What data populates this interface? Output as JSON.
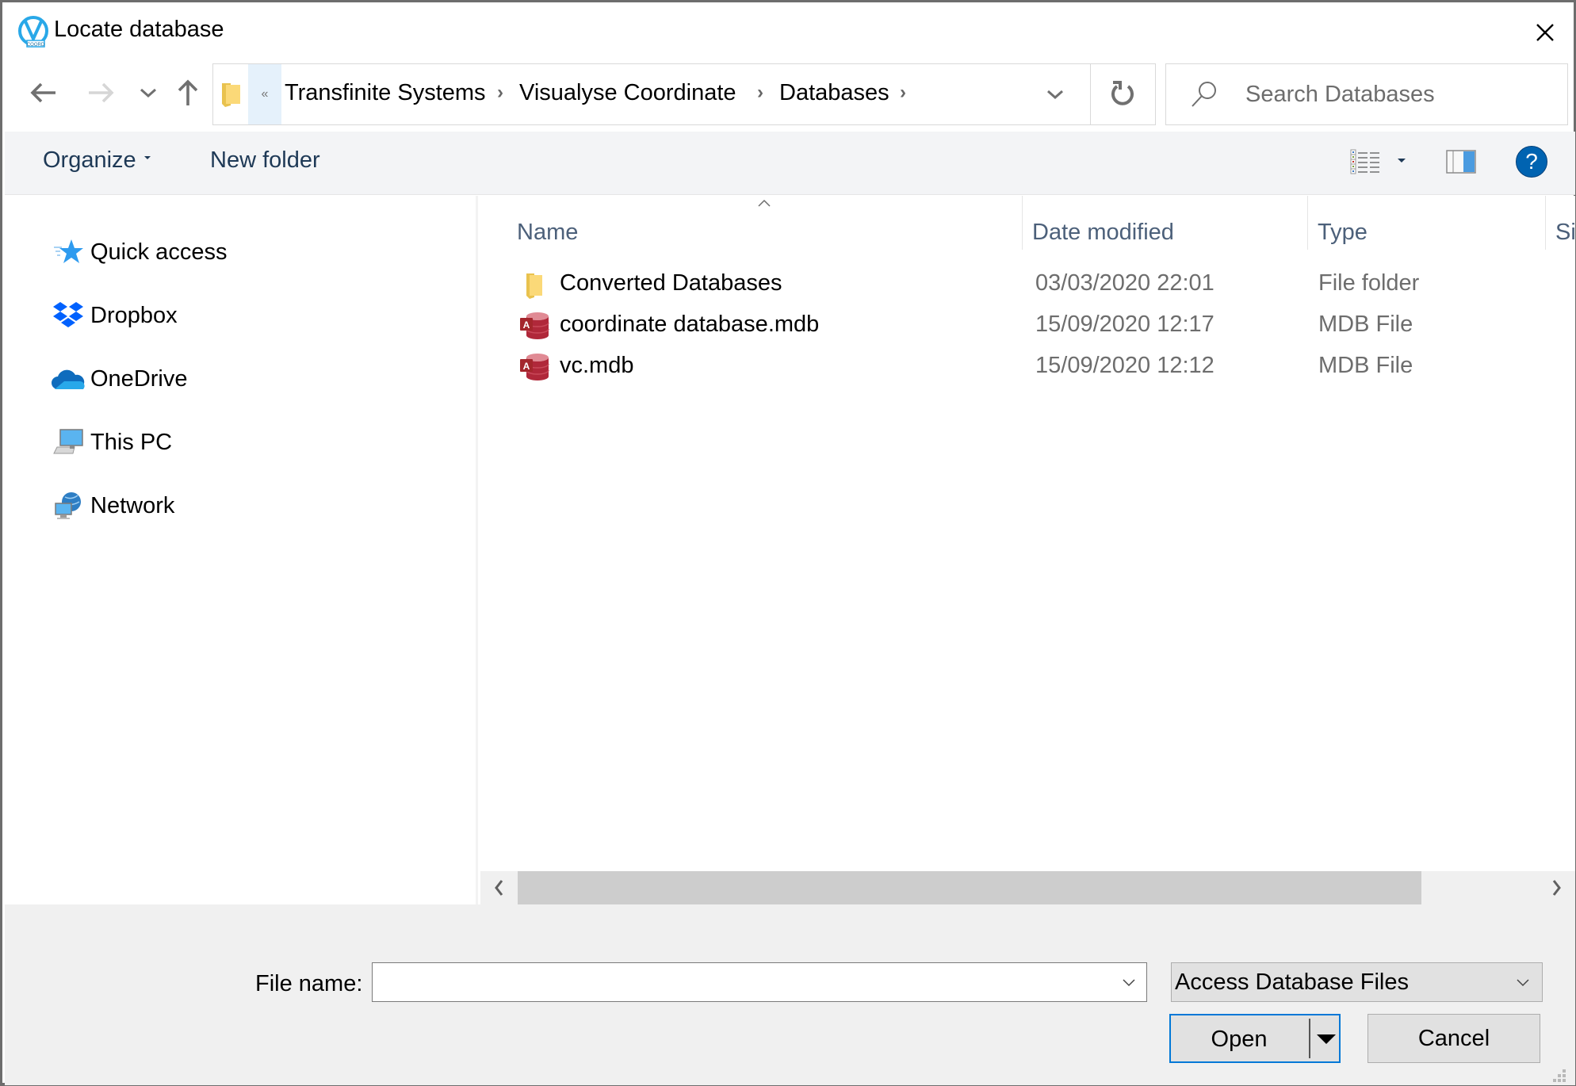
{
  "window": {
    "title": "Locate database",
    "app_icon": "visualyse-coord-icon"
  },
  "nav": {
    "back_icon": "arrow-left-icon",
    "forward_icon": "arrow-right-icon",
    "recent_icon": "chevron-down-icon",
    "up_icon": "arrow-up-icon",
    "overflow_label": "«",
    "breadcrumbs": [
      {
        "label": "Transfinite Systems"
      },
      {
        "label": "Visualyse Coordinate"
      },
      {
        "label": "Databases"
      }
    ],
    "search_placeholder": "Search Databases",
    "search_value": ""
  },
  "toolbar": {
    "organize_label": "Organize",
    "new_folder_label": "New folder",
    "help_label": "?"
  },
  "sidebar": {
    "items": [
      {
        "label": "Quick access",
        "icon": "star-icon"
      },
      {
        "label": "Dropbox",
        "icon": "dropbox-icon"
      },
      {
        "label": "OneDrive",
        "icon": "onedrive-cloud-icon"
      },
      {
        "label": "This PC",
        "icon": "computer-icon"
      },
      {
        "label": "Network",
        "icon": "network-icon"
      }
    ]
  },
  "file_list": {
    "columns": [
      {
        "label": "Name"
      },
      {
        "label": "Date modified"
      },
      {
        "label": "Type"
      },
      {
        "label": "Size"
      }
    ],
    "sorted_by": "Name",
    "rows": [
      {
        "name": "Converted Databases",
        "date": "03/03/2020 22:01",
        "type": "File folder",
        "icon": "folder-icon"
      },
      {
        "name": "coordinate database.mdb",
        "date": "15/09/2020 12:17",
        "type": "MDB File",
        "icon": "access-db-icon"
      },
      {
        "name": "vc.mdb",
        "date": "15/09/2020 12:12",
        "type": "MDB File",
        "icon": "access-db-icon"
      }
    ]
  },
  "bottom": {
    "file_name_label": "File name:",
    "file_name_value": "",
    "filter_selected": "Access Database Files",
    "open_label": "Open",
    "cancel_label": "Cancel"
  },
  "colors": {
    "accent": "#0078d7",
    "help_blue": "#0063b1",
    "toolbar_bg": "#f3f4f6",
    "bottom_bg": "#f0f0f0",
    "header_text": "#4c607a"
  }
}
